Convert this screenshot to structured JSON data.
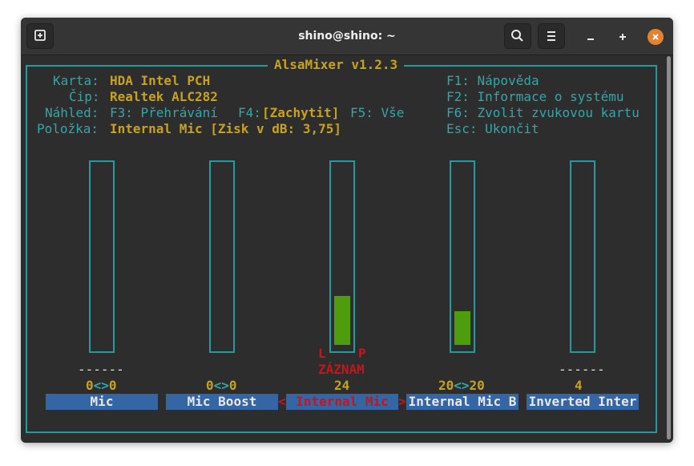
{
  "window": {
    "title": "shino@shino: ~"
  },
  "header": {
    "app_title": "AlsaMixer v1.2.3",
    "card_label": "Karta:",
    "card_value": "HDA Intel PCH",
    "chip_label": "Čip:",
    "chip_value": "Realtek ALC282",
    "view_label": "Náhled:",
    "view_f3": "F3: Přehrávání",
    "view_f4_key": "F4:",
    "view_f4_value": "[Zachytit]",
    "view_f5": "F5: Vše",
    "item_label": "Položka:",
    "item_value": "Internal Mic [Zisk v dB: 3,75]",
    "help_f1": "F1: Nápověda",
    "help_f2": "F2: Informace o systému",
    "help_f6": "F6: Zvolit zvukovou kartu",
    "help_esc": "Esc: Ukončit"
  },
  "channels": [
    {
      "name": "Mic",
      "value_left": "0",
      "value_right": "0",
      "separator": "<>",
      "dashes": "------",
      "level": 0
    },
    {
      "name": "Mic Boost",
      "value_left": "0",
      "value_right": "0",
      "separator": "<>",
      "level": 0
    },
    {
      "name": "Internal Mic",
      "value": "24",
      "capture_left": "L",
      "capture_right": "P",
      "capture_label": "ZÁZNAM",
      "selected": true,
      "sel_left": "<",
      "sel_right": ">",
      "level": 0.26
    },
    {
      "name": "Internal Mic B",
      "value_left": "20",
      "value_right": "20",
      "separator": "<>",
      "level": 0.18
    },
    {
      "name": "Inverted Inter",
      "value": "4",
      "dashes": "------",
      "level": 0
    }
  ],
  "colors": {
    "accent": "#1f9ca0",
    "highlight": "#c9a21b",
    "meter": "#4e9d0c",
    "selected_text": "#c4161c",
    "label_bg": "#3465a4",
    "close_button": "#e5812f"
  }
}
